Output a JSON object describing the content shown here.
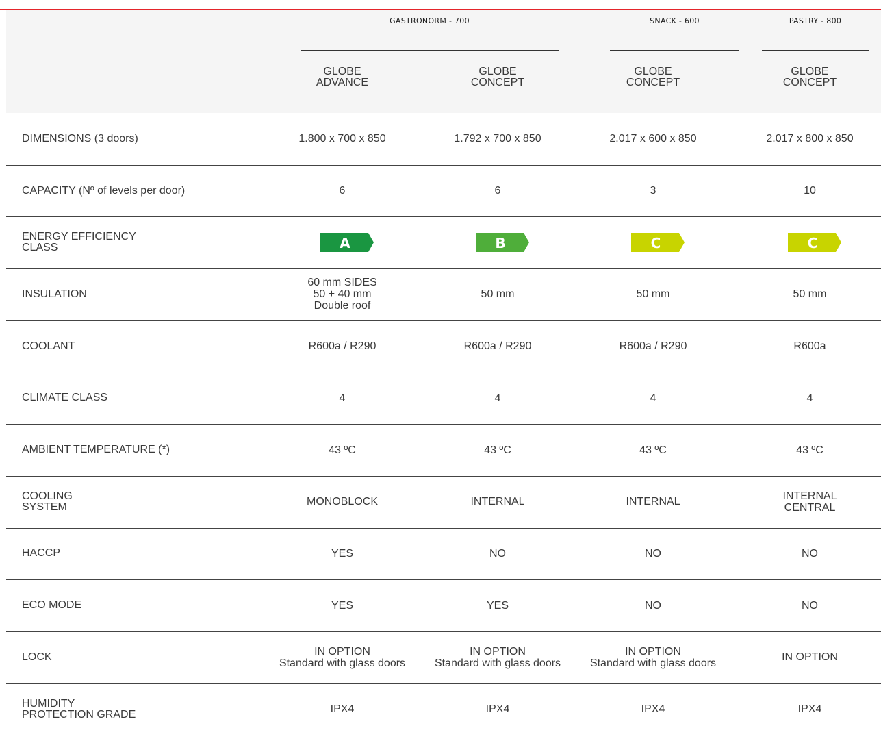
{
  "groups": [
    "GASTRONORM - 700",
    "SNACK - 600",
    "PASTRY - 800"
  ],
  "models": [
    "GLOBE\nADVANCE",
    "GLOBE\nCONCEPT",
    "GLOBE\nCONCEPT",
    "GLOBE\nCONCEPT"
  ],
  "rows": [
    {
      "label": "DIMENSIONS (3 doors)",
      "values": [
        "1.800 x 700 x 850",
        "1.792 x 700 x 850",
        "2.017 x 600 x 850",
        "2.017 x 800 x 850"
      ]
    },
    {
      "label": "CAPACITY  (Nº of levels per door)",
      "values": [
        "6",
        "6",
        "3",
        "10"
      ]
    },
    {
      "label": "ENERGY EFFICIENCY\nCLASS",
      "badges": [
        {
          "letter": "A",
          "color": "#1a9641"
        },
        {
          "letter": "B",
          "color": "#4fae3a"
        },
        {
          "letter": "C",
          "color": "#c8d400"
        },
        {
          "letter": "C",
          "color": "#c8d400"
        }
      ]
    },
    {
      "label": "INSULATION",
      "values": [
        "60 mm SIDES\n50 + 40 mm\nDouble roof",
        "50 mm",
        "50 mm",
        "50 mm"
      ]
    },
    {
      "label": "COOLANT",
      "values": [
        "R600a / R290",
        "R600a / R290",
        "R600a / R290",
        "R600a"
      ]
    },
    {
      "label": "CLIMATE CLASS",
      "values": [
        "4",
        "4",
        "4",
        "4"
      ]
    },
    {
      "label": "AMBIENT TEMPERATURE (*)",
      "values": [
        "43 ºC",
        "43 ºC",
        "43 ºC",
        "43 ºC"
      ]
    },
    {
      "label": "COOLING\nSYSTEM",
      "values": [
        "MONOBLOCK",
        "INTERNAL",
        "INTERNAL",
        "INTERNAL\nCENTRAL"
      ]
    },
    {
      "label": "HACCP",
      "values": [
        "YES",
        "NO",
        "NO",
        "NO"
      ]
    },
    {
      "label": "ECO MODE",
      "values": [
        "YES",
        "YES",
        "NO",
        "NO"
      ]
    },
    {
      "label": "LOCK",
      "values": [
        "IN OPTION\nStandard with glass doors",
        "IN OPTION\nStandard with glass doors",
        "IN OPTION\nStandard with glass doors",
        "IN OPTION"
      ]
    },
    {
      "label": "HUMIDITY\nPROTECTION  GRADE",
      "values": [
        "IPX4",
        "IPX4",
        "IPX4",
        "IPX4"
      ]
    }
  ],
  "colors": {
    "accent_line": "#e4252b",
    "header_bg": "#f5f5f5"
  }
}
